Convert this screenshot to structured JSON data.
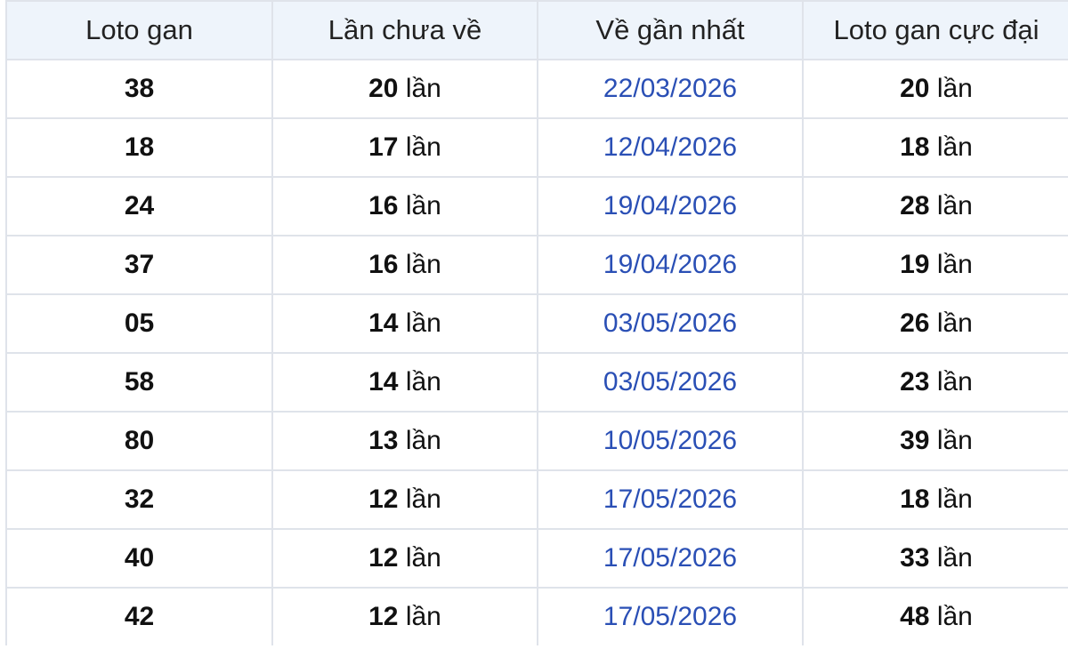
{
  "table": {
    "headers": [
      "Loto gan",
      "Lần chưa về",
      "Về gần nhất",
      "Loto gan cực đại"
    ],
    "unit": "lần",
    "rows": [
      {
        "loto": "38",
        "missed": "20",
        "last_date": "22/03/2026",
        "max_gap": "20"
      },
      {
        "loto": "18",
        "missed": "17",
        "last_date": "12/04/2026",
        "max_gap": "18"
      },
      {
        "loto": "24",
        "missed": "16",
        "last_date": "19/04/2026",
        "max_gap": "28"
      },
      {
        "loto": "37",
        "missed": "16",
        "last_date": "19/04/2026",
        "max_gap": "19"
      },
      {
        "loto": "05",
        "missed": "14",
        "last_date": "03/05/2026",
        "max_gap": "26"
      },
      {
        "loto": "58",
        "missed": "14",
        "last_date": "03/05/2026",
        "max_gap": "23"
      },
      {
        "loto": "80",
        "missed": "13",
        "last_date": "10/05/2026",
        "max_gap": "39"
      },
      {
        "loto": "32",
        "missed": "12",
        "last_date": "17/05/2026",
        "max_gap": "18"
      },
      {
        "loto": "40",
        "missed": "12",
        "last_date": "17/05/2026",
        "max_gap": "33"
      },
      {
        "loto": "42",
        "missed": "12",
        "last_date": "17/05/2026",
        "max_gap": "48"
      }
    ]
  },
  "colors": {
    "header_bg": "#eef4fb",
    "border": "#dfe3ea",
    "date_text": "#2a4fb5"
  }
}
